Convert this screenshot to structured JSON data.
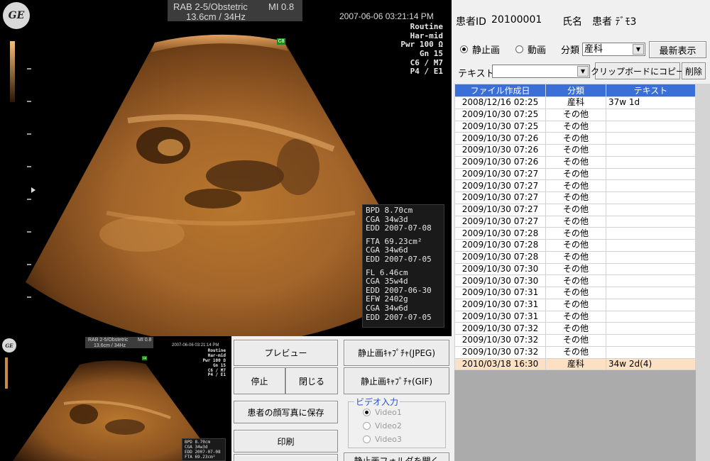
{
  "ultrasound": {
    "logo": "GE",
    "probe_label": "RAB 2-5/Obstetric",
    "mi_label": "MI 0.8",
    "depth_freq": "13.6cm / 34Hz",
    "datetime": "2007-06-06 03:21:14 PM",
    "params": [
      "Routine",
      "Har-mid",
      "Pwr 100 Ω",
      "Gn 15",
      "C6 / M7",
      "P4 / E1"
    ],
    "probe_badge": "C8",
    "measurements": [
      [
        "BPD 8.70cm",
        "CGA 34w3d",
        "EDD 2007-07-08"
      ],
      [
        "FTA 69.23cm²",
        "CGA 34w6d",
        "EDD 2007-07-05"
      ],
      [
        "FL 6.46cm",
        "CGA 35w4d",
        "EDD 2007-06-30",
        "EFW 2402g",
        "CGA 34w6d",
        "EDD 2007-07-05"
      ]
    ],
    "thumb_measurements": [
      "BPD 8.70cm",
      "CGA 34w3d",
      "EDD 2007-07-08",
      "FTA 69.23cm²"
    ]
  },
  "patient": {
    "id_label": "患者ID",
    "id_value": "20100001",
    "name_label": "氏名",
    "name_value": "患者 ﾃﾞﾓ3"
  },
  "filters": {
    "still_label": "静止画",
    "video_label": "動画",
    "category_label": "分類",
    "category_value": "産科",
    "refresh_button": "最新表示",
    "text_label": "テキスト",
    "text_value": "",
    "clipboard_button": "クリップボードにコピー",
    "delete_button": "削除"
  },
  "table": {
    "headers": [
      "ファイル作成日",
      "分類",
      "テキスト"
    ],
    "rows": [
      [
        "2008/12/16 02:25",
        "産科",
        "37w 1d"
      ],
      [
        "2009/10/30 07:25",
        "その他",
        ""
      ],
      [
        "2009/10/30 07:25",
        "その他",
        ""
      ],
      [
        "2009/10/30 07:26",
        "その他",
        ""
      ],
      [
        "2009/10/30 07:26",
        "その他",
        ""
      ],
      [
        "2009/10/30 07:26",
        "その他",
        ""
      ],
      [
        "2009/10/30 07:27",
        "その他",
        ""
      ],
      [
        "2009/10/30 07:27",
        "その他",
        ""
      ],
      [
        "2009/10/30 07:27",
        "その他",
        ""
      ],
      [
        "2009/10/30 07:27",
        "その他",
        ""
      ],
      [
        "2009/10/30 07:27",
        "その他",
        ""
      ],
      [
        "2009/10/30 07:28",
        "その他",
        ""
      ],
      [
        "2009/10/30 07:28",
        "その他",
        ""
      ],
      [
        "2009/10/30 07:28",
        "その他",
        ""
      ],
      [
        "2009/10/30 07:30",
        "その他",
        ""
      ],
      [
        "2009/10/30 07:30",
        "その他",
        ""
      ],
      [
        "2009/10/30 07:31",
        "その他",
        ""
      ],
      [
        "2009/10/30 07:31",
        "その他",
        ""
      ],
      [
        "2009/10/30 07:31",
        "その他",
        ""
      ],
      [
        "2009/10/30 07:32",
        "その他",
        ""
      ],
      [
        "2009/10/30 07:32",
        "その他",
        ""
      ],
      [
        "2009/10/30 07:32",
        "その他",
        ""
      ],
      [
        "2010/03/18 16:30",
        "産科",
        "34w 2d(4)"
      ]
    ],
    "selected_index": 22
  },
  "controls": {
    "preview_button": "プレビュー",
    "stop_button": "停止",
    "close_button": "閉じる",
    "save_face_button": "患者の顔写真に保存",
    "print_button": "印刷",
    "capture_jpeg_button": "静止画ｷｬﾌﾟﾁｬ(JPEG)",
    "capture_gif_button": "静止画ｷｬﾌﾟﾁｬ(GIF)",
    "video_input_legend": "ビデオ入力",
    "video_options": [
      "Video1",
      "Video2",
      "Video3"
    ],
    "open_folder_button": "静止画フォルダを開く"
  },
  "colors": {
    "header_blue": "#3a6fd8",
    "selected_row": "#fce0c4",
    "legend_blue": "#2a4fd0"
  }
}
